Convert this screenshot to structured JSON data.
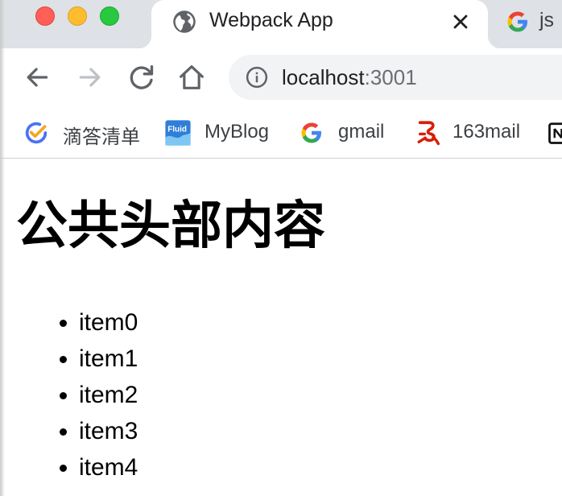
{
  "browser": {
    "active_tab": {
      "title": "Webpack App",
      "favicon": "globe-icon"
    },
    "inactive_tab": {
      "title": "js",
      "favicon": "google-g-icon"
    },
    "address_bar": {
      "host": "localhost",
      "port": ":3001"
    },
    "bookmarks": [
      {
        "label": "滴答清单",
        "icon": "ticktick-icon"
      },
      {
        "label": "MyBlog",
        "icon": "fluid-icon"
      },
      {
        "label": "gmail",
        "icon": "google-g-icon"
      },
      {
        "label": "163mail",
        "icon": "netease-163-icon"
      }
    ],
    "colors": {
      "tabstrip": "#dee1e6",
      "traffic_close": "#fe5f57",
      "traffic_minimize": "#febc2e",
      "traffic_maximize": "#28c840"
    }
  },
  "page": {
    "heading": "公共头部内容",
    "items": [
      "item0",
      "item1",
      "item2",
      "item3",
      "item4"
    ]
  }
}
